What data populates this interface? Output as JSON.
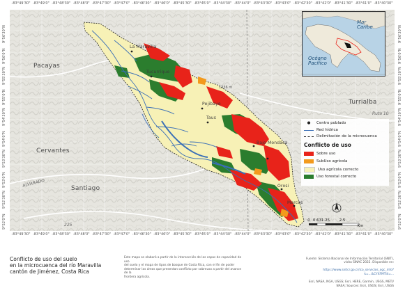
{
  "map": {
    "top_ticks": [
      "-83°49'30\"",
      "-83°49'0\"",
      "-83°48'30\"",
      "-83°48'0\"",
      "-83°47'30\"",
      "-83°47'0\"",
      "-83°46'30\"",
      "-83°46'0\"",
      "-83°45'30\"",
      "-83°45'0\"",
      "-83°44'30\"",
      "-83°44'0\"",
      "-83°43'30\"",
      "-83°43'0\"",
      "-83°42'30\"",
      "-83°42'0\"",
      "-83°41'30\"",
      "-83°41'0\"",
      "-83°40'30\""
    ],
    "left_ticks": [
      "9°56'30\"N",
      "9°56'0\"N",
      "9°55'30\"N",
      "9°55'0\"N",
      "9°54'30\"N",
      "9°54'0\"N",
      "9°53'30\"N",
      "9°53'0\"N",
      "9°52'30\"N",
      "9°52'0\"N"
    ],
    "right_ticks": [
      "9°56'30\"N",
      "9°56'0\"N",
      "9°55'30\"N",
      "9°55'0\"N",
      "9°54'30\"N",
      "9°54'0\"N",
      "9°53'30\"N",
      "9°53'0\"N",
      "9°52'30\"N",
      "9°52'0\"N"
    ],
    "places": {
      "pacayas": "Pacayas",
      "turrialba": "Turrialba",
      "cervantes": "Cervantes",
      "santiago": "Santiago",
      "alvarado": "ALVARADO",
      "elev_1": "1336 m",
      "road_1": "Ruta 10",
      "road_2": "225"
    },
    "towns": [
      "La Maravilla",
      "Tucurrique",
      "Pejibaye",
      "Taus",
      "Bajo Mondaca",
      "Orosi",
      "Marcos"
    ],
    "colors": {
      "sobre_uso": "#e8231a",
      "subuso": "#f39a1c",
      "agricola_correcto": "#f7f1b6",
      "forestal_correcto": "#2b7d2e",
      "red_hidrica": "#3a6fb7"
    }
  },
  "inset": {
    "mar_caribe": "Mar Caribe",
    "oceano_pacifico": "Océano Pacífico"
  },
  "legend": {
    "centro_poblado": "Centro poblado",
    "red_hidrica": "Red hídrica",
    "delimitacion": "Delimitación de la microcuenca",
    "title": "Conflicto de uso",
    "items": [
      {
        "label": "Sobre uso",
        "color": "#e8231a"
      },
      {
        "label": "SubUso agrícola",
        "color": "#f39a1c"
      },
      {
        "label": "Uso agrícola correcto",
        "color": "#f7f1b6"
      },
      {
        "label": "Uso forestal correcto",
        "color": "#2b7d2e"
      }
    ]
  },
  "scale": {
    "labels": [
      "0",
      "0.63",
      "1.25",
      "2.5"
    ],
    "unit": "Km"
  },
  "north": "N",
  "caption": "Conflicto de uso del suelo\nen la microcuenca del río Maravilla\ncantón de Jiménez, Costa Rica",
  "note": "Este mapa se elaboró a partir de la intersección de las capas de capacidad de uso\ndel suelo y el mapa de tipos de bosque de Costa Rica, con el fin de poder\ndeterminar las áreas que presentan conflicto por sobreuso a partir del avance de la\nfrontera agrícola.",
  "source": {
    "text": "Fuente: Sistema Nacional de Información Territorial (SNIT),\nvisita SINAC 2022. Disponible en:",
    "link": "https://www.snitcr.go.cr/ico_servicios_ogc_info?\nk=...&CYXFMTl4=...",
    "credits": "Esri, NASA, NGA, USGS; Esri, HERE, Garmin, USGS, METI/\nNASA; Sources: Esri, USGS; Esri, USGS"
  }
}
